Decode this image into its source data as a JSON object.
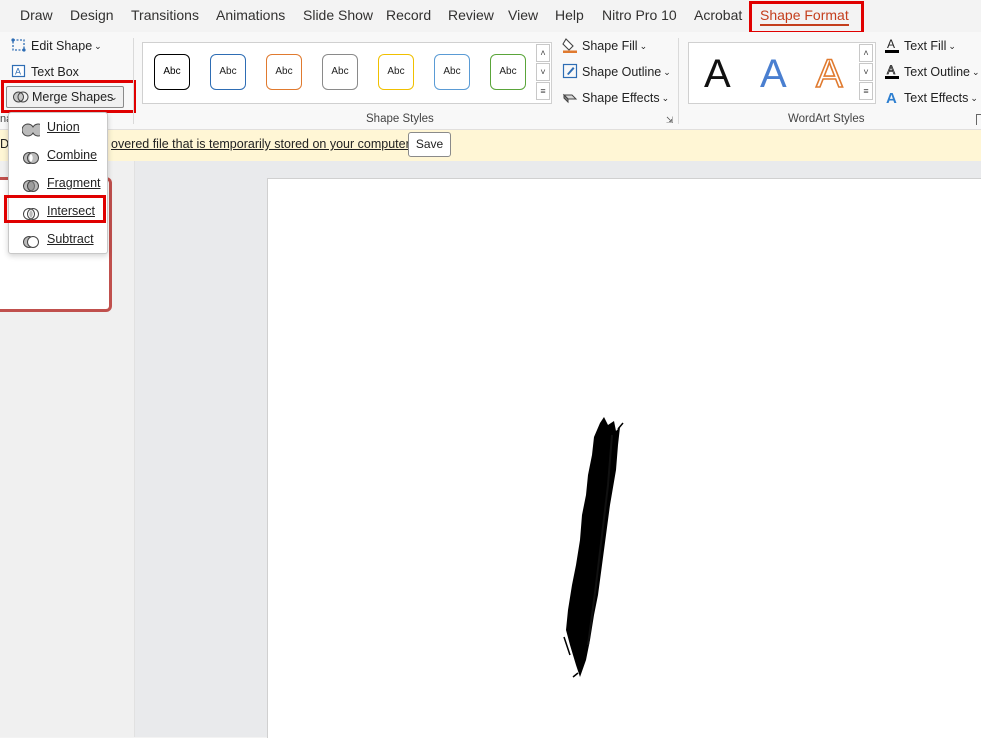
{
  "tabs": [
    {
      "label": "Draw",
      "active": false
    },
    {
      "label": "Design",
      "active": false
    },
    {
      "label": "Transitions",
      "active": false
    },
    {
      "label": "Animations",
      "active": false
    },
    {
      "label": "Slide Show",
      "active": false
    },
    {
      "label": "Record",
      "active": false
    },
    {
      "label": "Review",
      "active": false
    },
    {
      "label": "View",
      "active": false
    },
    {
      "label": "Help",
      "active": false
    },
    {
      "label": "Nitro Pro 10",
      "active": false
    },
    {
      "label": "Acrobat",
      "active": false
    },
    {
      "label": "Shape Format",
      "active": true
    }
  ],
  "insert_shapes": {
    "edit_shape": "Edit Shape",
    "text_box": "Text Box",
    "merge_shapes": "Merge Shapes",
    "group_label_fragment": "na"
  },
  "shape_styles": {
    "gallery": [
      {
        "text": "Abc",
        "color": "#000000"
      },
      {
        "text": "Abc",
        "color": "#2e6db4"
      },
      {
        "text": "Abc",
        "color": "#e07a2f"
      },
      {
        "text": "Abc",
        "color": "#8a8a8a"
      },
      {
        "text": "Abc",
        "color": "#f0c000"
      },
      {
        "text": "Abc",
        "color": "#5a9bd5"
      },
      {
        "text": "Abc",
        "color": "#5aa53a"
      }
    ],
    "shape_fill": "Shape Fill",
    "shape_outline": "Shape Outline",
    "shape_effects": "Shape Effects",
    "group_label": "Shape Styles"
  },
  "wordart_styles": {
    "letters": [
      {
        "text": "A",
        "style": "black-fill"
      },
      {
        "text": "A",
        "style": "blue-gradient"
      },
      {
        "text": "A",
        "style": "orange-outline"
      }
    ],
    "text_fill": "Text Fill",
    "text_outline": "Text Outline",
    "text_effects": "Text Effects",
    "group_label": "WordArt Styles"
  },
  "message_bar": {
    "lead": "D",
    "text": "overed file that is temporarily stored on your computer.",
    "save_label": "Save"
  },
  "merge_menu": {
    "items": [
      {
        "label": "Union",
        "icon": "union-icon"
      },
      {
        "label": "Combine",
        "icon": "combine-icon"
      },
      {
        "label": "Fragment",
        "icon": "fragment-icon"
      },
      {
        "label": "Intersect",
        "icon": "intersect-icon",
        "highlighted": true
      },
      {
        "label": "Subtract",
        "icon": "subtract-icon"
      }
    ]
  },
  "colors": {
    "accent": "#c43e1c",
    "highlight_box": "#e00000",
    "message_bar_bg": "#fff6d5"
  }
}
